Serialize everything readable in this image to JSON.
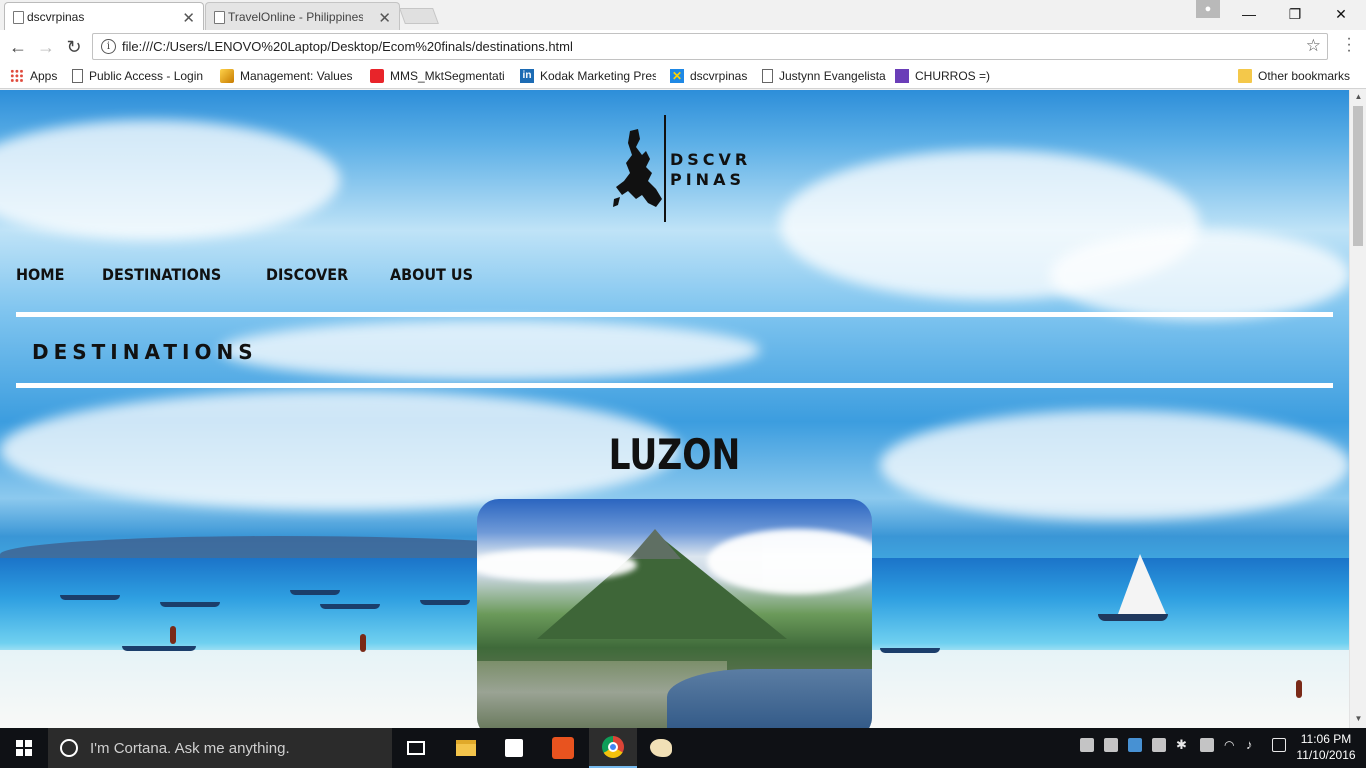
{
  "browser": {
    "tabs": [
      {
        "title": "dscvrpinas",
        "active": true
      },
      {
        "title": "TravelOnline - Philippines",
        "active": false
      }
    ],
    "url": "file:///C:/Users/LENOVO%20Laptop/Desktop/Ecom%20finals/destinations.html",
    "bookmarks": [
      {
        "label": "Apps",
        "icon": "apps-grid-icon"
      },
      {
        "label": "Public Access - Login",
        "icon": "page-icon"
      },
      {
        "label": "Management: Values",
        "icon": "management-icon"
      },
      {
        "label": "MMS_MktSegmentati",
        "icon": "mms-icon"
      },
      {
        "label": "Kodak Marketing Pres",
        "icon": "linkedin-icon"
      },
      {
        "label": "dscvrpinas",
        "icon": "x-icon"
      },
      {
        "label": "Justynn Evangelista",
        "icon": "page-icon"
      },
      {
        "label": "CHURROS =)",
        "icon": "list-icon"
      }
    ],
    "other_bookmarks": "Other bookmarks"
  },
  "site": {
    "logo_line1": "DSCVR",
    "logo_line2": "PINAS",
    "nav": [
      "HOME",
      "DESTINATIONS",
      "DISCOVER",
      "ABOUT US"
    ],
    "section_heading": "DESTINATIONS",
    "region_title": "LUZON"
  },
  "taskbar": {
    "search_placeholder": "I'm Cortana. Ask me anything.",
    "time": "11:06 PM",
    "date": "11/10/2016"
  },
  "colors": {
    "taskbar": "#0f1115",
    "page_text": "#111111",
    "rule": "#ffffff"
  }
}
